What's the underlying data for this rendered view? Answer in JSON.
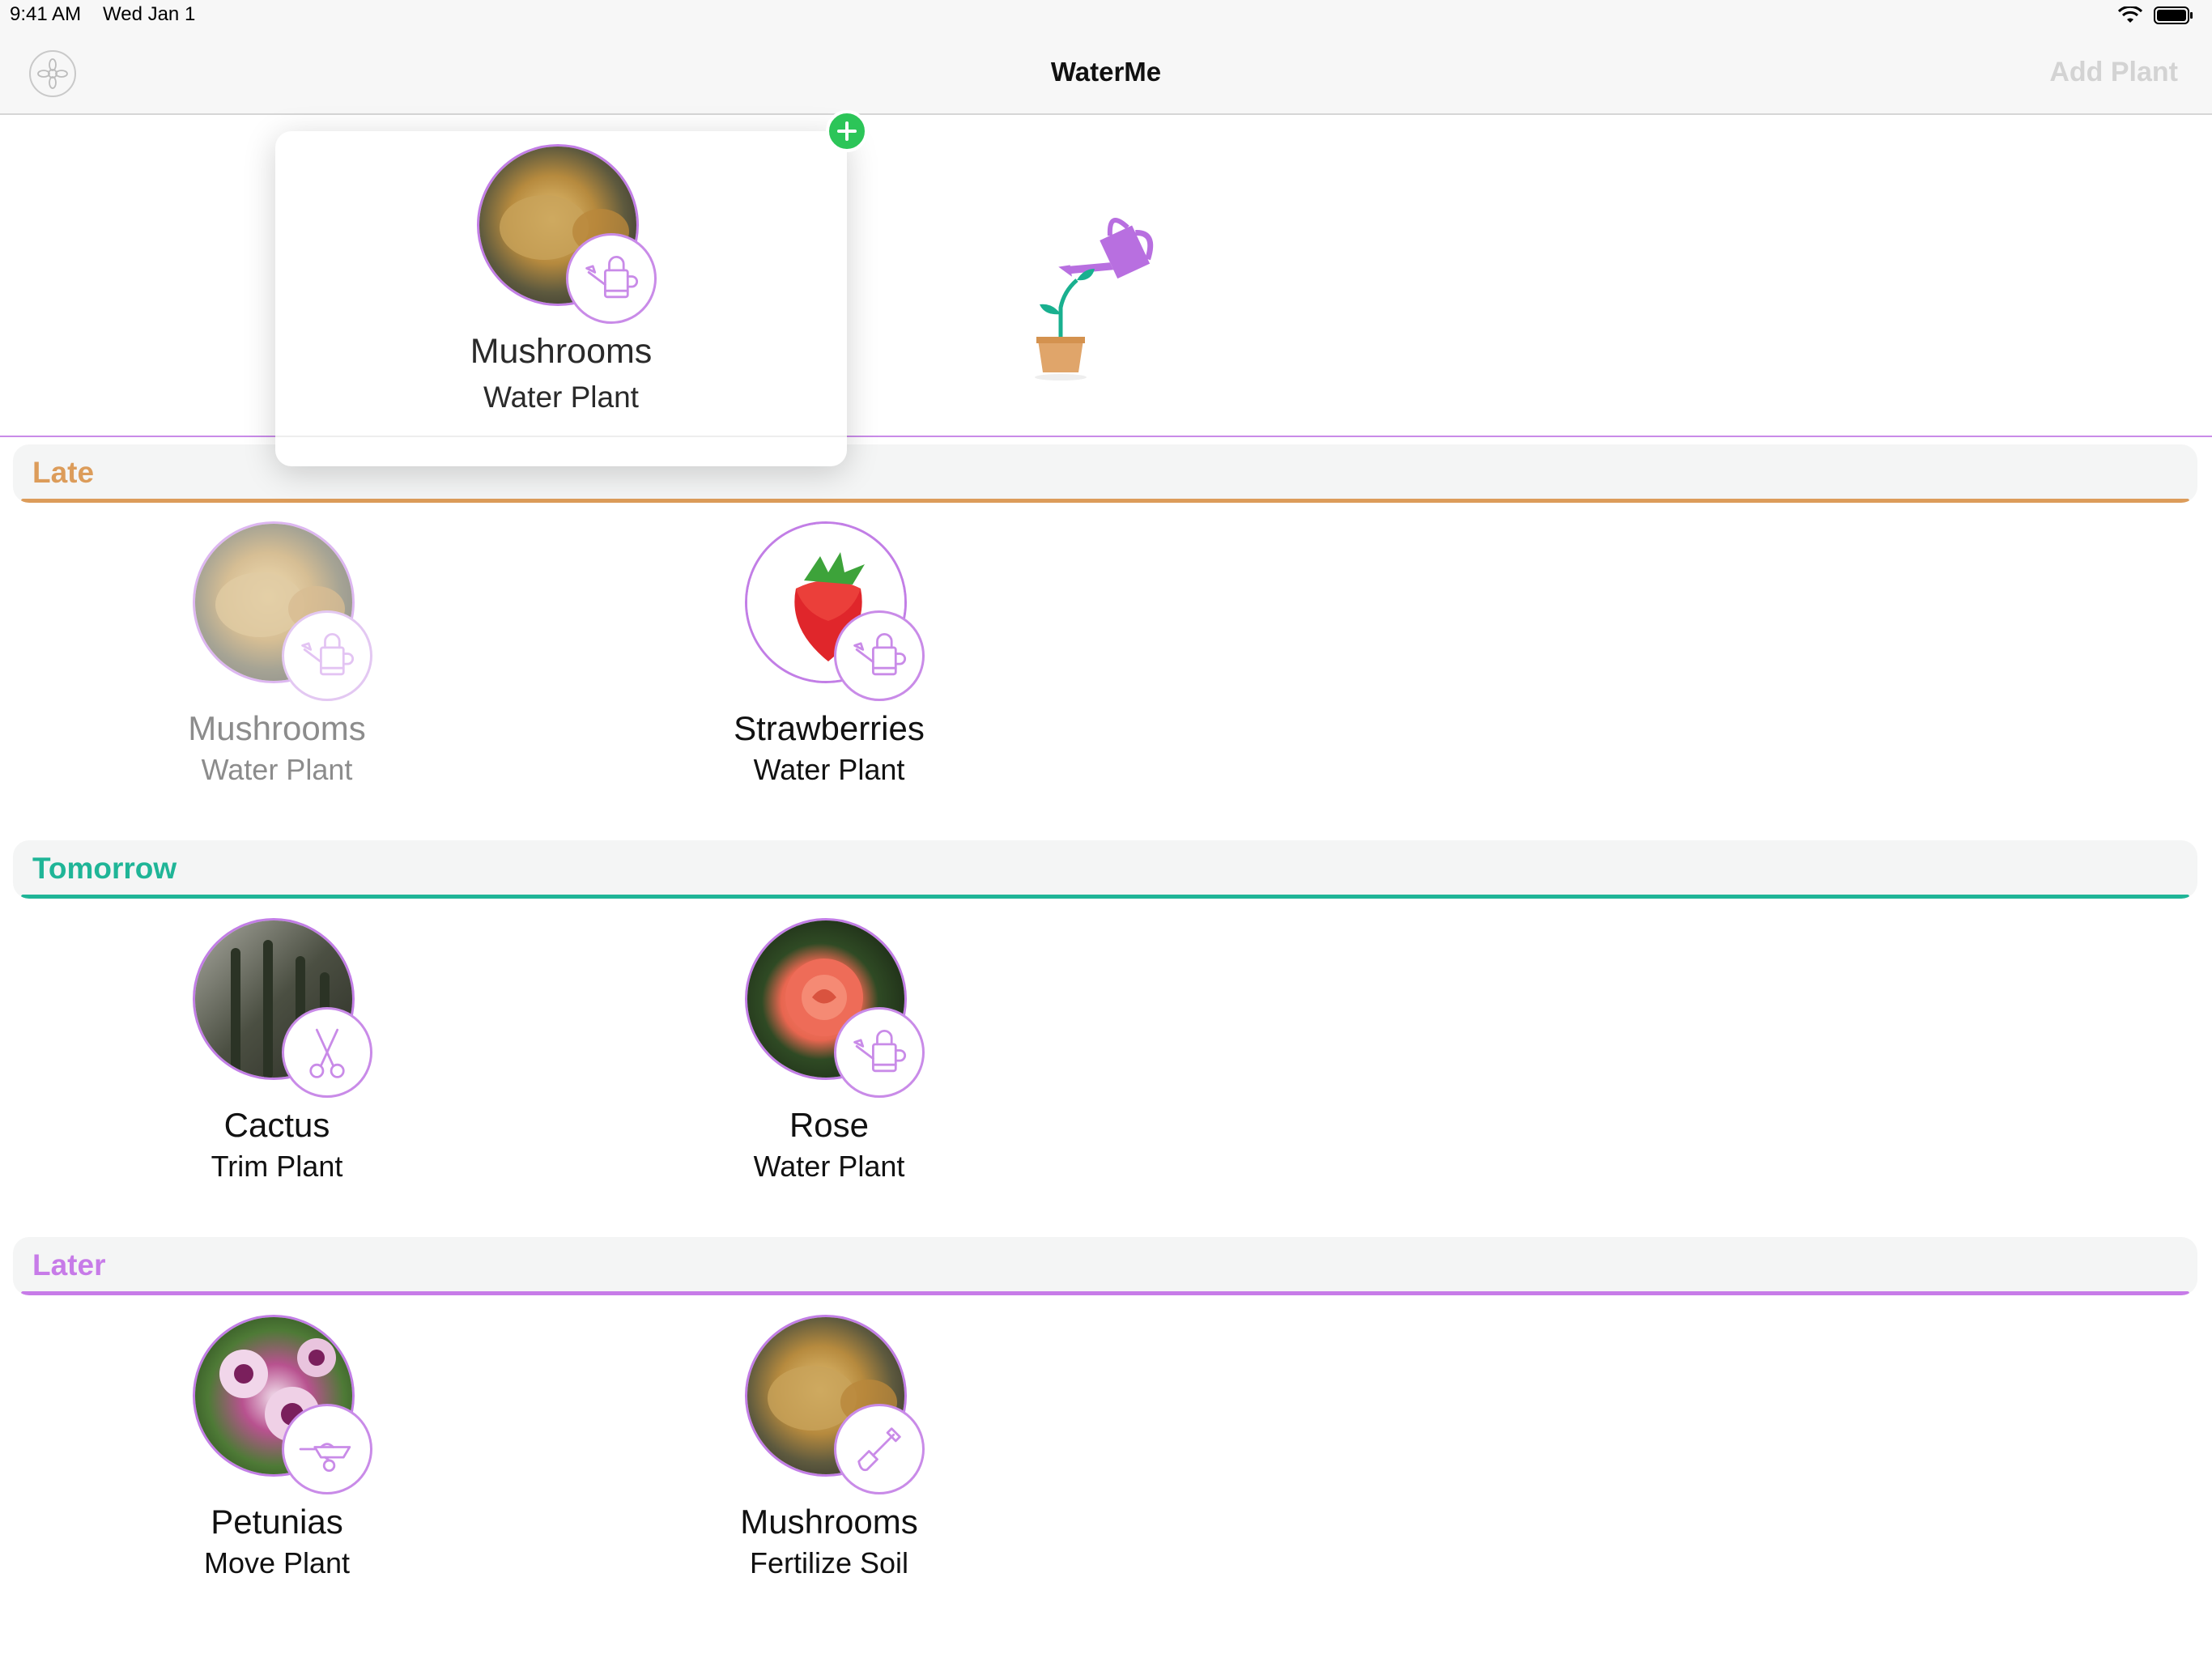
{
  "status_bar": {
    "time": "9:41 AM",
    "date": "Wed Jan 1"
  },
  "nav": {
    "title": "WaterMe",
    "add_label": "Add Plant",
    "settings_icon": "settings-flower-icon"
  },
  "drag_card": {
    "name": "Mushrooms",
    "task": "Water Plant",
    "photo": "mushrooms-photo",
    "task_icon": "watering-can-icon"
  },
  "colors": {
    "accent": "#b86fe0",
    "late": "#dc9c5a",
    "tomorrow": "#1fb597",
    "later": "#c77be8",
    "add_green": "#2cc558"
  },
  "sections": [
    {
      "title": "Late",
      "color": "#dc9c5a",
      "items": [
        {
          "name": "Mushrooms",
          "task": "Water Plant",
          "photo": "mushrooms-photo",
          "task_icon": "watering-can-icon",
          "faded": true
        },
        {
          "name": "Strawberries",
          "task": "Water Plant",
          "photo": "strawberry-photo",
          "task_icon": "watering-can-icon",
          "faded": false
        }
      ]
    },
    {
      "title": "Tomorrow",
      "color": "#1fb597",
      "items": [
        {
          "name": "Cactus",
          "task": "Trim Plant",
          "photo": "cactus-photo",
          "task_icon": "scissors-icon",
          "faded": false
        },
        {
          "name": "Rose",
          "task": "Water Plant",
          "photo": "rose-photo",
          "task_icon": "watering-can-icon",
          "faded": false
        }
      ]
    },
    {
      "title": "Later",
      "color": "#c77be8",
      "items": [
        {
          "name": "Petunias",
          "task": "Move Plant",
          "photo": "petunias-photo",
          "task_icon": "wheelbarrow-icon",
          "faded": false
        },
        {
          "name": "Mushrooms",
          "task": "Fertilize Soil",
          "photo": "mushrooms-photo",
          "task_icon": "shovel-icon",
          "faded": false
        }
      ]
    }
  ]
}
